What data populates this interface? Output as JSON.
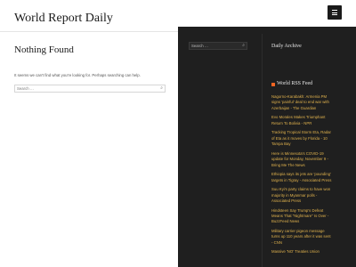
{
  "header": {
    "site_title": "World Report Daily",
    "menu_icon": "hamburger-icon"
  },
  "main": {
    "page_title": "Nothing Found",
    "message": "It seems we can't find what you're looking for. Perhaps searching can help.",
    "search": {
      "placeholder": "Search …",
      "icon": "search-icon"
    }
  },
  "sidebar": {
    "search": {
      "placeholder": "Search …",
      "icon": "search-icon"
    },
    "archive_title": "Daily Archive",
    "rss_title": "World RSS Feed",
    "rss_items": [
      "Nagorno-Karabakh: Armenia PM signs 'painful' deal to end war with Azerbaijan - The Guardian",
      "Evo Morales Makes Triumphant Return To Bolivia - NPR",
      "Tracking Tropical Storm Eta, Radar of Eta as it moves by Florida - 10 Tampa Bay",
      "Here is Minnesota's COVID-19 update for Monday, November 9 - Bring Me The News",
      "Ethiopia says its jets are 'pounding' targets in Tigray - Associated Press",
      "Suu Kyi's party claims to have won majority in Myanmar polls - Associated Press",
      "Hindsteen Say Trump's Defeat Means That \"Nightmare\" Is Over - BuzzFeed News",
      "Military carrier pigeon message turns up 110 years after it was sent - CNN",
      "Massive 'NO' Treaties Union"
    ]
  },
  "colors": {
    "dark_panel": "#1f1f1f",
    "link": "#e0b24d",
    "rss": "#f26522"
  }
}
